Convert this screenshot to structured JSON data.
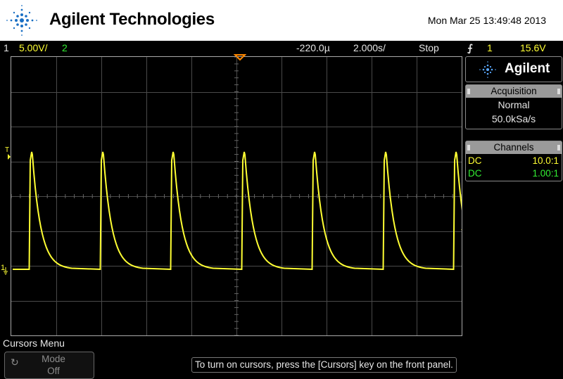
{
  "header": {
    "brand": "Agilent Technologies",
    "datetime": "Mon Mar 25 13:49:48 2013"
  },
  "status": {
    "ch1_num": "1",
    "ch1_scale": "5.00V/",
    "ch2_num": "2",
    "delay": "-220.0µ",
    "timebase": "2.000s/",
    "run_state": "Stop",
    "trigger_icon": "falling-edge-trigger-icon",
    "trigger_glyph": "⨍",
    "trigger_source": "1",
    "trigger_level": "15.6V"
  },
  "screen": {
    "trigger_marker": "T",
    "ground_marker": "1"
  },
  "panel": {
    "brand": "Agilent",
    "acquisition": {
      "title": "Acquisition",
      "mode": "Normal",
      "rate": "50.0kSa/s"
    },
    "channels": {
      "title": "Channels",
      "ch1": {
        "coupling": "DC",
        "probe": "10.0:1"
      },
      "ch2": {
        "coupling": "DC",
        "probe": "1.00:1"
      }
    }
  },
  "bottom": {
    "menu_title": "Cursors Menu",
    "softkey_label": "Mode",
    "softkey_value": "Off",
    "hint": "To turn on cursors, press the [Cursors] key on the front panel."
  },
  "colors": {
    "ch1": "#ffff33",
    "ch2": "#33ee33",
    "grid": "#4a4a4a",
    "trigger_marker": "#ff8800"
  }
}
